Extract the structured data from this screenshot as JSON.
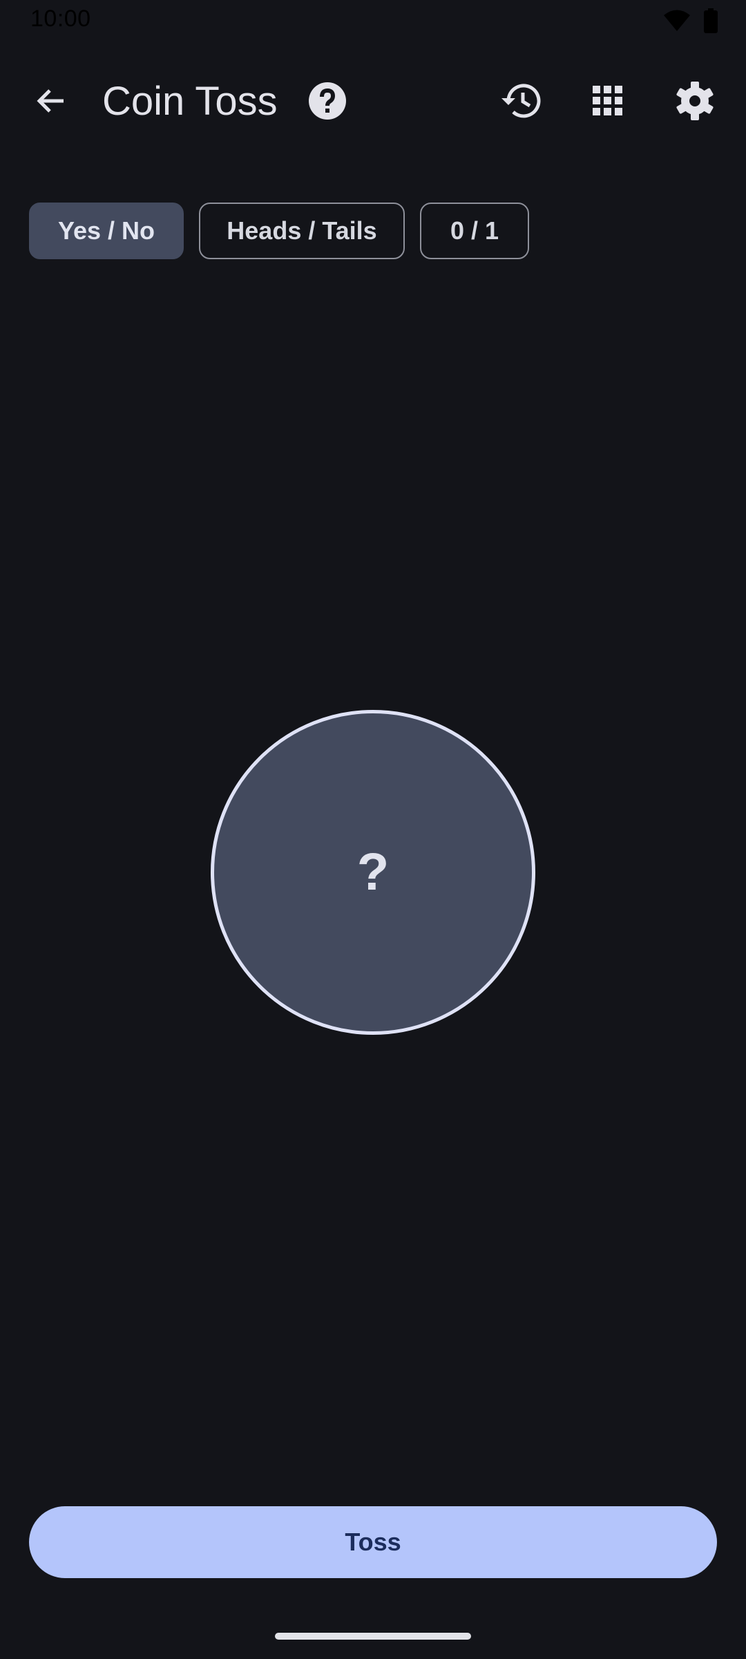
{
  "status_bar": {
    "time": "10:00",
    "icons": [
      "wifi-icon",
      "battery-icon"
    ]
  },
  "app_bar": {
    "title": "Coin Toss",
    "icons": {
      "back": "arrow-left-icon",
      "help": "help-circle-icon",
      "history": "history-icon",
      "grid": "grid-icon",
      "settings": "gear-icon"
    }
  },
  "modes": [
    {
      "label": "Yes / No",
      "selected": true
    },
    {
      "label": "Heads / Tails",
      "selected": false
    },
    {
      "label": "0 / 1",
      "selected": false
    }
  ],
  "coin": {
    "face": "?"
  },
  "actions": {
    "toss_label": "Toss"
  },
  "colors": {
    "background": "#131419",
    "accent": "#b4c5fb",
    "chip_selected": "#434a5e",
    "coin_fill": "#434a5e",
    "coin_border": "#dfe2f6"
  }
}
